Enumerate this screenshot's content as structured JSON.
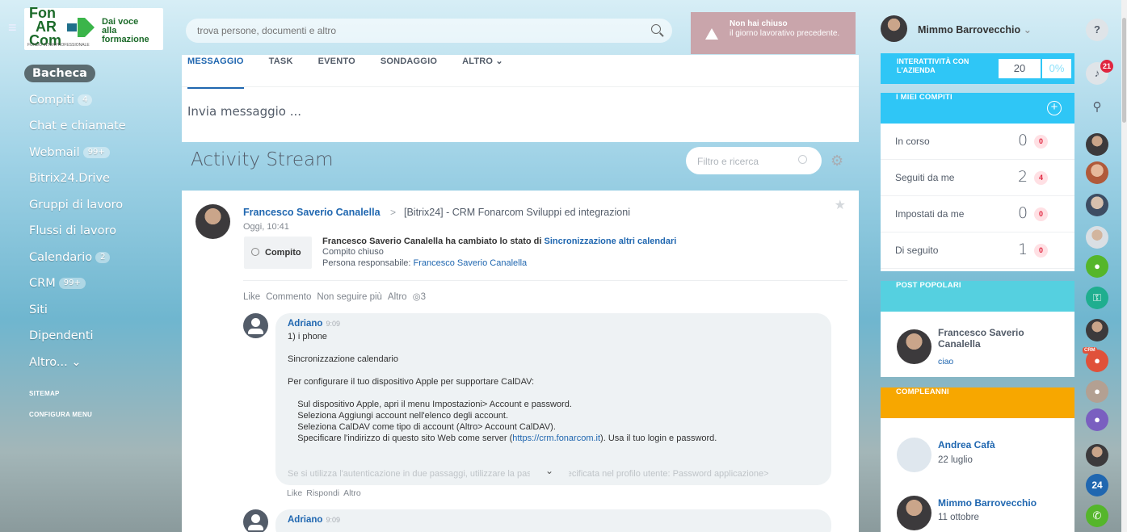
{
  "logo": {
    "line1": "Fon",
    "line2": "AR",
    "line3": "Com",
    "tagline1": "Dai voce",
    "tagline2": "alla formazione",
    "small": "FONDO INTERPROFESSIONALE"
  },
  "menu": {
    "items": [
      {
        "label": "Bacheca",
        "badge": ""
      },
      {
        "label": "Compiti",
        "badge": "4"
      },
      {
        "label": "Chat e chiamate",
        "badge": ""
      },
      {
        "label": "Webmail",
        "badge": "99+"
      },
      {
        "label": "Bitrix24.Drive",
        "badge": ""
      },
      {
        "label": "Gruppi di lavoro",
        "badge": ""
      },
      {
        "label": "Flussi di lavoro",
        "badge": ""
      },
      {
        "label": "Calendario",
        "badge": "2"
      },
      {
        "label": "CRM",
        "badge": "99+"
      },
      {
        "label": "Siti",
        "badge": ""
      },
      {
        "label": "Dipendenti",
        "badge": ""
      },
      {
        "label": "Altro... ⌄",
        "badge": ""
      }
    ],
    "sitemap": "SITEMAP",
    "configure": "CONFIGURA MENU"
  },
  "search": {
    "placeholder": "trova persone, documenti e altro"
  },
  "warning": {
    "title": "Non hai chiuso",
    "text": "il giorno lavorativo precedente."
  },
  "composer": {
    "tabs": [
      "MESSAGGIO",
      "TASK",
      "EVENTO",
      "SONDAGGIO",
      "ALTRO ⌄"
    ],
    "placeholder": "Invia messaggio ..."
  },
  "stream": {
    "title": "Activity Stream",
    "filter_placeholder": "Filtro e ricerca"
  },
  "post": {
    "author": "Francesco Saverio Canalella",
    "separator": ">",
    "group": "[Bitrix24] - CRM Fonarcom Sviluppi ed integrazioni",
    "time": "Oggi, 10:41",
    "task_label": "Compito",
    "task_line1_prefix": "Francesco Saverio Canalella ha cambiato lo stato di ",
    "task_line1_link": "Sincronizzazione altri calendari",
    "task_line2": "Compito chiuso",
    "task_line3_prefix": "Persona responsabile: ",
    "task_line3_link": "Francesco Saverio Canalella",
    "actions": [
      "Like",
      "Commento",
      "Non seguire più",
      "Altro",
      "◎3"
    ]
  },
  "comments": [
    {
      "author": "Adriano",
      "time": "9:09",
      "lines": [
        "1) i phone",
        "",
        "Sincronizzazione calendario",
        "",
        "Per configurare il tuo dispositivo Apple per supportare CalDAV:",
        "",
        "    Sul dispositivo Apple, apri il menu Impostazioni> Account e password.",
        "    Seleziona Aggiungi account nell'elenco degli account.",
        "    Seleziona CalDAV come tipo di account (Altro> Account CalDAV)."
      ],
      "link_line_prefix": "    Specificare l'indirizzo di questo sito Web come server (",
      "link": "https://crm.fonarcom.it",
      "link_line_suffix": "). Usa il tuo login e password.",
      "faded": "    Se si utilizza l'autenticazione in due passaggi, utilizzare la password specificata nel profilo utente: Password applicazione>",
      "more": "⌄",
      "actions": [
        "Like",
        "Rispondi",
        "Altro"
      ]
    },
    {
      "author": "Adriano",
      "time": "9:09"
    }
  ],
  "user": {
    "name": "Mimmo Barrovecchio"
  },
  "interactivity": {
    "label": "INTERATTIVITÀ CON L'AZIENDA",
    "value": "20",
    "percent": "0%"
  },
  "my_tasks": {
    "title": "I MIEI COMPITI",
    "rows": [
      {
        "name": "In corso",
        "count": "0",
        "badge": "0"
      },
      {
        "name": "Seguiti da me",
        "count": "2",
        "badge": "4"
      },
      {
        "name": "Impostati da me",
        "count": "0",
        "badge": "0"
      },
      {
        "name": "Di seguito",
        "count": "1",
        "badge": "0"
      }
    ]
  },
  "popular": {
    "title": "POST POPOLARI",
    "name": "Francesco Saverio Canalella",
    "text": "ciao"
  },
  "birthdays": {
    "title": "COMPLEANNI",
    "people": [
      {
        "name": "Andrea Cafà",
        "date": "22 luglio"
      },
      {
        "name": "Mimmo Barrovecchio",
        "date": "11 ottobre"
      }
    ]
  },
  "iconbar": {
    "help": "?",
    "notifications": "21",
    "calendar_day": "24",
    "crm_tag": "CRM"
  },
  "colors": {
    "accent": "#2067b0",
    "cyan": "#2fc6f6",
    "orange": "#f7a700",
    "green": "#55b62b",
    "purple": "#7a5fc0"
  }
}
